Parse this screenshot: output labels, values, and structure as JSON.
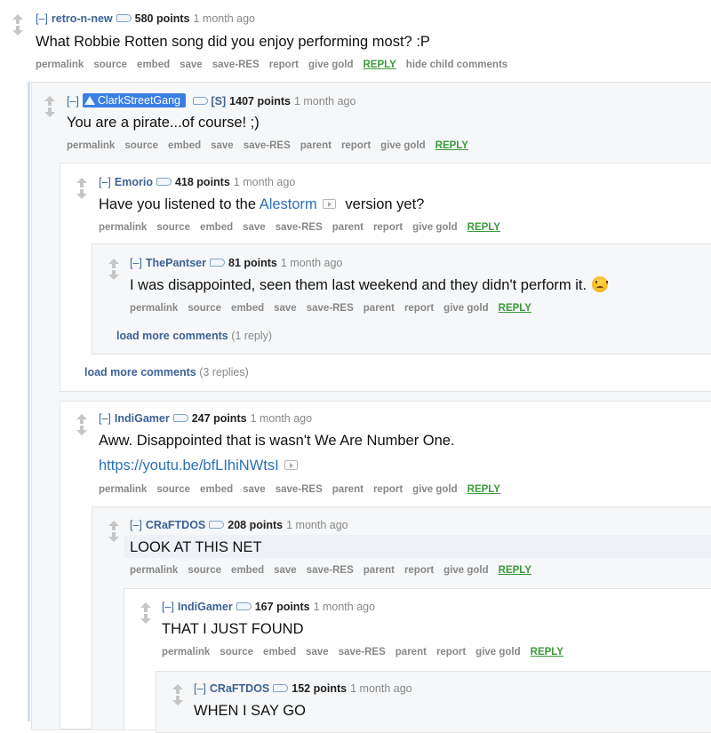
{
  "buttons_std": [
    "permalink",
    "source",
    "embed",
    "save",
    "save-RES"
  ],
  "comments": {
    "c1": {
      "toggle": "[–]",
      "author": "retro-n-new",
      "score": "580 points",
      "time": "1 month ago",
      "body": "What Robbie Rotten song did you enjoy performing most? :P",
      "buttons": [
        "permalink",
        "source",
        "embed",
        "save",
        "save-RES",
        "report",
        "give gold"
      ],
      "reply": "REPLY",
      "extra": "hide child comments"
    },
    "c2": {
      "toggle": "[–]",
      "author": "ClarkStreetGang",
      "submitter": "[S]",
      "score": "1407 points",
      "time": "1 month ago",
      "body": "You are a pirate...of course! ;)",
      "buttons": [
        "permalink",
        "source",
        "embed",
        "save",
        "save-RES",
        "parent",
        "report",
        "give gold"
      ],
      "reply": "REPLY"
    },
    "c3": {
      "toggle": "[–]",
      "author": "Emorio",
      "score": "418 points",
      "time": "1 month ago",
      "body_pre": "Have you listened to the ",
      "body_link": "Alestorm",
      "body_post": " version yet?",
      "buttons": [
        "permalink",
        "source",
        "embed",
        "save",
        "save-RES",
        "parent",
        "report",
        "give gold"
      ],
      "reply": "REPLY"
    },
    "c4": {
      "toggle": "[–]",
      "author": "ThePantser",
      "score": "81 points",
      "time": "1 month ago",
      "body": "I was disappointed, seen them last weekend and they didn't perform it.",
      "buttons": [
        "permalink",
        "source",
        "embed",
        "save",
        "save-RES",
        "parent",
        "report",
        "give gold"
      ],
      "reply": "REPLY",
      "load_more": "load more comments",
      "load_more_count": "(1 reply)"
    },
    "c3_load_more": {
      "link": "load more comments",
      "count": "(3 replies)"
    },
    "c5": {
      "toggle": "[–]",
      "author": "IndiGamer",
      "score": "247 points",
      "time": "1 month ago",
      "body": "Aww. Disappointed that is wasn't We Are Number One.",
      "link": "https://youtu.be/bfLIhiNWtsI",
      "buttons": [
        "permalink",
        "source",
        "embed",
        "save",
        "save-RES",
        "parent",
        "report",
        "give gold"
      ],
      "reply": "REPLY"
    },
    "c6": {
      "toggle": "[–]",
      "author": "CRaFTDOS",
      "score": "208 points",
      "time": "1 month ago",
      "body": "LOOK AT THIS NET",
      "buttons": [
        "permalink",
        "source",
        "embed",
        "save",
        "save-RES",
        "parent",
        "report",
        "give gold"
      ],
      "reply": "REPLY"
    },
    "c7": {
      "toggle": "[–]",
      "author": "IndiGamer",
      "score": "167 points",
      "time": "1 month ago",
      "body": "THAT I JUST FOUND",
      "buttons": [
        "permalink",
        "source",
        "embed",
        "save",
        "save-RES",
        "parent",
        "report",
        "give gold"
      ],
      "reply": "REPLY"
    },
    "c8": {
      "toggle": "[–]",
      "author": "CRaFTDOS",
      "score": "152 points",
      "time": "1 month ago",
      "body": "WHEN I SAY GO"
    }
  },
  "colors": {
    "author": "#3d6295",
    "reply": "#3b9a3b",
    "link": "#2b72b8",
    "op_badge": "#3a7ee4",
    "box_shade": "#f6f7f8"
  },
  "icons": [
    "upvote-icon",
    "downvote-icon",
    "tag-icon",
    "media-expando-icon",
    "emoji-icon"
  ]
}
